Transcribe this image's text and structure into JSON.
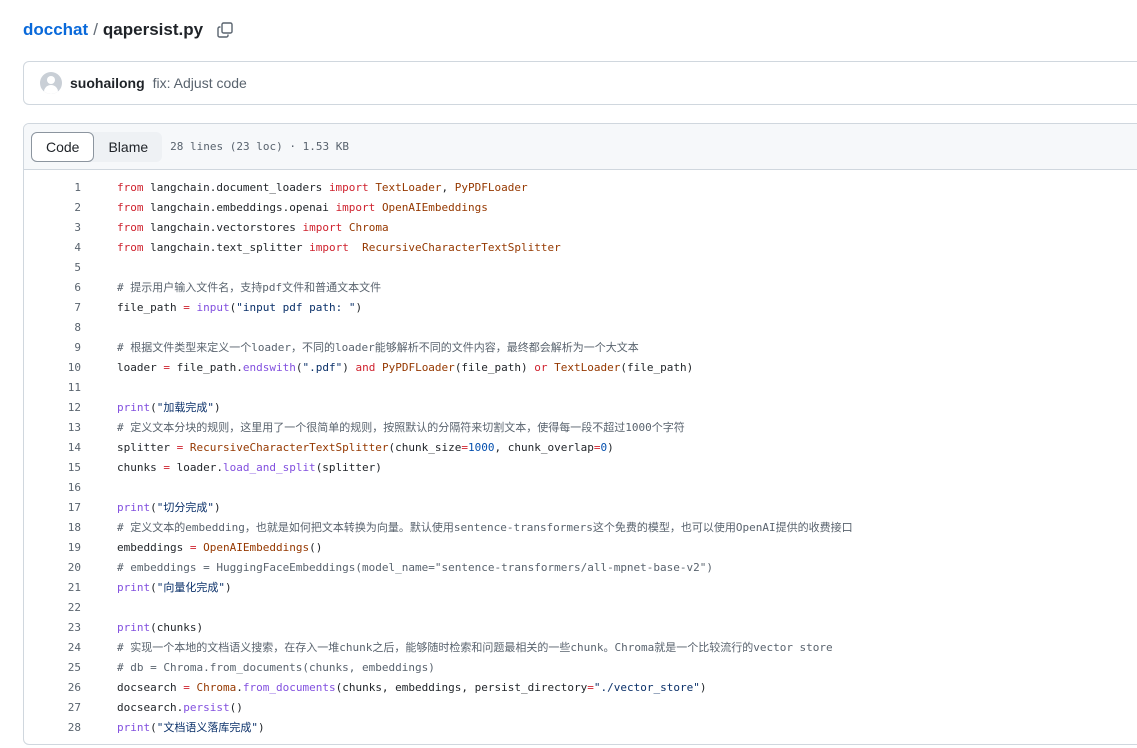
{
  "breadcrumb": {
    "repo": "docchat",
    "separator": "/",
    "file": "qapersist.py"
  },
  "commit": {
    "author": "suohailong",
    "message": "fix: Adjust code"
  },
  "file_header": {
    "tabs": [
      "Code",
      "Blame"
    ],
    "active_tab": "Code",
    "meta": "28 lines (23 loc) · 1.53 KB"
  },
  "colors": {
    "keyword": "#cf222e",
    "function": "#8250df",
    "class": "#953800",
    "string": "#0a3069",
    "number": "#0550ae",
    "comment": "#59636e",
    "link": "#0969da"
  },
  "code_lines": [
    [
      [
        "kw",
        "from"
      ],
      [
        "t",
        " langchain.document_loaders "
      ],
      [
        "kw",
        "import"
      ],
      [
        "t",
        " "
      ],
      [
        "cls",
        "TextLoader"
      ],
      [
        "t",
        ", "
      ],
      [
        "cls",
        "PyPDFLoader"
      ]
    ],
    [
      [
        "kw",
        "from"
      ],
      [
        "t",
        " langchain.embeddings.openai "
      ],
      [
        "kw",
        "import"
      ],
      [
        "t",
        " "
      ],
      [
        "cls",
        "OpenAIEmbeddings"
      ]
    ],
    [
      [
        "kw",
        "from"
      ],
      [
        "t",
        " langchain.vectorstores "
      ],
      [
        "kw",
        "import"
      ],
      [
        "t",
        " "
      ],
      [
        "cls",
        "Chroma"
      ]
    ],
    [
      [
        "kw",
        "from"
      ],
      [
        "t",
        " langchain.text_splitter "
      ],
      [
        "kw",
        "import"
      ],
      [
        "t",
        "  "
      ],
      [
        "cls",
        "RecursiveCharacterTextSplitter"
      ]
    ],
    [],
    [
      [
        "cm",
        "# 提示用户输入文件名，支持pdf文件和普通文本文件"
      ]
    ],
    [
      [
        "t",
        "file_path "
      ],
      [
        "kw",
        "="
      ],
      [
        "t",
        " "
      ],
      [
        "fn",
        "input"
      ],
      [
        "t",
        "("
      ],
      [
        "str",
        "\"input pdf path: \""
      ],
      [
        "t",
        ")"
      ]
    ],
    [],
    [
      [
        "cm",
        "# 根据文件类型来定义一个loader，不同的loader能够解析不同的文件内容，最终都会解析为一个大文本"
      ]
    ],
    [
      [
        "t",
        "loader "
      ],
      [
        "kw",
        "="
      ],
      [
        "t",
        " file_path."
      ],
      [
        "fn",
        "endswith"
      ],
      [
        "t",
        "("
      ],
      [
        "str",
        "\".pdf\""
      ],
      [
        "t",
        ") "
      ],
      [
        "kw",
        "and"
      ],
      [
        "t",
        " "
      ],
      [
        "cls",
        "PyPDFLoader"
      ],
      [
        "t",
        "(file_path) "
      ],
      [
        "kw",
        "or"
      ],
      [
        "t",
        " "
      ],
      [
        "cls",
        "TextLoader"
      ],
      [
        "t",
        "(file_path)"
      ]
    ],
    [],
    [
      [
        "fn",
        "print"
      ],
      [
        "t",
        "("
      ],
      [
        "str",
        "\"加载完成\""
      ],
      [
        "t",
        ")"
      ]
    ],
    [
      [
        "cm",
        "# 定义文本分块的规则，这里用了一个很简单的规则，按照默认的分隔符来切割文本，使得每一段不超过1000个字符"
      ]
    ],
    [
      [
        "t",
        "splitter "
      ],
      [
        "kw",
        "="
      ],
      [
        "t",
        " "
      ],
      [
        "cls",
        "RecursiveCharacterTextSplitter"
      ],
      [
        "t",
        "(chunk_size"
      ],
      [
        "kw",
        "="
      ],
      [
        "num",
        "1000"
      ],
      [
        "t",
        ", chunk_overlap"
      ],
      [
        "kw",
        "="
      ],
      [
        "num",
        "0"
      ],
      [
        "t",
        ")"
      ]
    ],
    [
      [
        "t",
        "chunks "
      ],
      [
        "kw",
        "="
      ],
      [
        "t",
        " loader."
      ],
      [
        "fn",
        "load_and_split"
      ],
      [
        "t",
        "(splitter)"
      ]
    ],
    [],
    [
      [
        "fn",
        "print"
      ],
      [
        "t",
        "("
      ],
      [
        "str",
        "\"切分完成\""
      ],
      [
        "t",
        ")"
      ]
    ],
    [
      [
        "cm",
        "# 定义文本的embedding，也就是如何把文本转换为向量。默认使用sentence-transformers这个免费的模型，也可以使用OpenAI提供的收费接口"
      ]
    ],
    [
      [
        "t",
        "embeddings "
      ],
      [
        "kw",
        "="
      ],
      [
        "t",
        " "
      ],
      [
        "cls",
        "OpenAIEmbeddings"
      ],
      [
        "t",
        "()"
      ]
    ],
    [
      [
        "cm",
        "# embeddings = HuggingFaceEmbeddings(model_name=\"sentence-transformers/all-mpnet-base-v2\")"
      ]
    ],
    [
      [
        "fn",
        "print"
      ],
      [
        "t",
        "("
      ],
      [
        "str",
        "\"向量化完成\""
      ],
      [
        "t",
        ")"
      ]
    ],
    [],
    [
      [
        "fn",
        "print"
      ],
      [
        "t",
        "(chunks)"
      ]
    ],
    [
      [
        "cm",
        "# 实现一个本地的文档语义搜索，在存入一堆chunk之后，能够随时检索和问题最相关的一些chunk。Chroma就是一个比较流行的vector store"
      ]
    ],
    [
      [
        "cm",
        "# db = Chroma.from_documents(chunks, embeddings)"
      ]
    ],
    [
      [
        "t",
        "docsearch "
      ],
      [
        "kw",
        "="
      ],
      [
        "t",
        " "
      ],
      [
        "cls",
        "Chroma"
      ],
      [
        "t",
        "."
      ],
      [
        "fn",
        "from_documents"
      ],
      [
        "t",
        "(chunks, embeddings, persist_directory"
      ],
      [
        "kw",
        "="
      ],
      [
        "str",
        "\"./vector_store\""
      ],
      [
        "t",
        ")"
      ]
    ],
    [
      [
        "t",
        "docsearch."
      ],
      [
        "fn",
        "persist"
      ],
      [
        "t",
        "()"
      ]
    ],
    [
      [
        "fn",
        "print"
      ],
      [
        "t",
        "("
      ],
      [
        "str",
        "\"文档语义落库完成\""
      ],
      [
        "t",
        ")"
      ]
    ]
  ]
}
